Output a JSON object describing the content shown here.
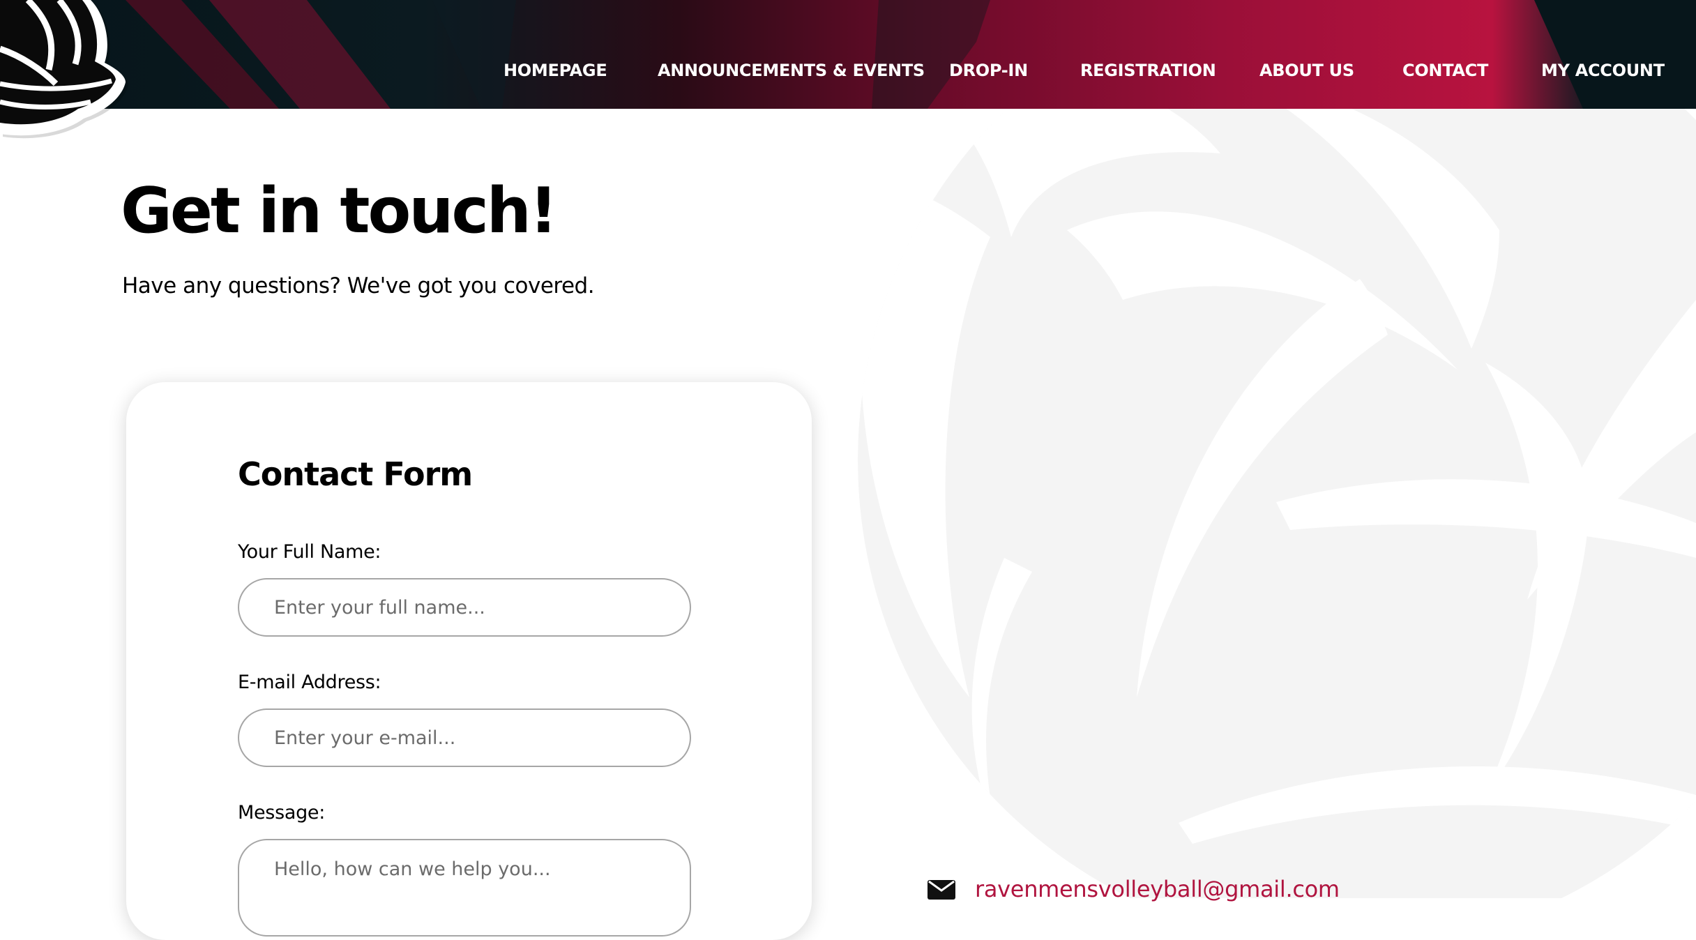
{
  "nav": {
    "items": [
      {
        "label": "HOMEPAGE"
      },
      {
        "label": "ANNOUNCEMENTS & EVENTS"
      },
      {
        "label": "DROP-IN"
      },
      {
        "label": "REGISTRATION"
      },
      {
        "label": "ABOUT US"
      },
      {
        "label": "CONTACT"
      },
      {
        "label": "MY ACCOUNT"
      }
    ]
  },
  "hero": {
    "title": "Get in touch!",
    "subtitle": "Have any questions? We've got you covered."
  },
  "form": {
    "title": "Contact Form",
    "name_label": "Your Full Name:",
    "name_placeholder": "Enter your full name...",
    "name_value": "",
    "email_label": "E-mail Address:",
    "email_placeholder": "Enter your e-mail...",
    "email_value": "",
    "message_label": "Message:",
    "message_placeholder": "Hello, how can we help you...",
    "message_value": ""
  },
  "contact": {
    "email": "ravenmensvolleyball@gmail.com"
  },
  "icons": {
    "logo": "raven-volleyball-logo",
    "email": "envelope-icon",
    "background": "volleyball-watermark"
  },
  "colors": {
    "accent": "#b0143f",
    "header_dark": "#06151a",
    "header_red": "#b8133f"
  }
}
